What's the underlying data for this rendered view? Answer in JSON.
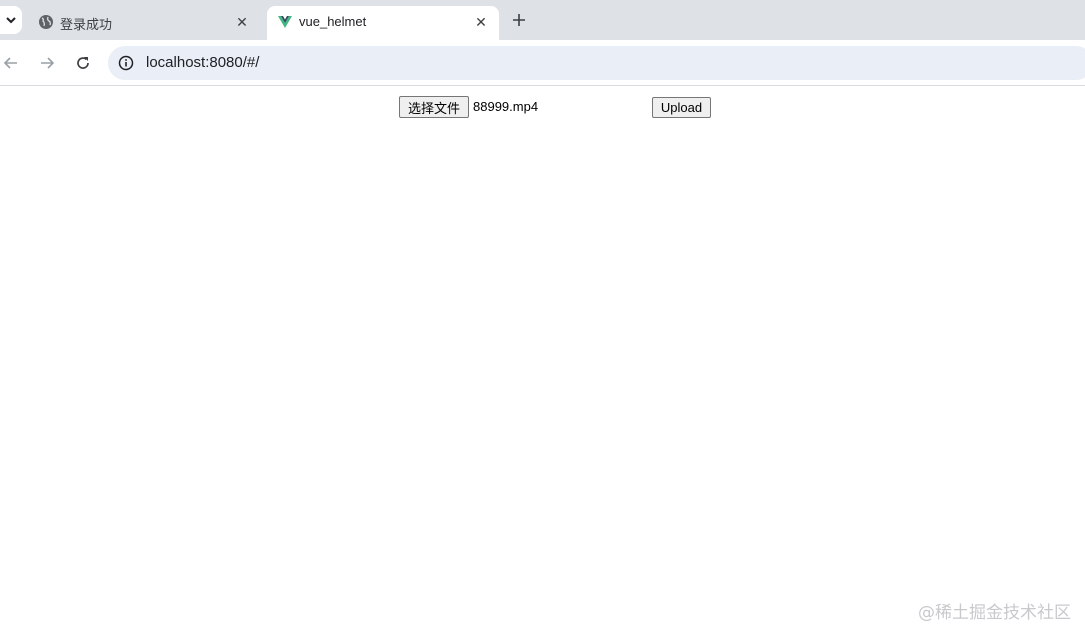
{
  "browser": {
    "tabs": [
      {
        "title": "登录成功",
        "favicon": "globe-icon",
        "active": false
      },
      {
        "title": "vue_helmet",
        "favicon": "vue-logo-icon",
        "active": true
      }
    ],
    "close_glyph": "✕",
    "new_tab_icon": "plus-icon",
    "address": "localhost:8080/#/"
  },
  "page": {
    "file_button_label": "选择文件",
    "file_name": "88999.mp4",
    "upload_label": "Upload"
  },
  "watermark": "@稀土掘金技术社区",
  "colors": {
    "tabbar": "#dee1e6",
    "omnibox": "#eaeef7",
    "vue_green": "#41b883",
    "vue_dark": "#35495e"
  }
}
